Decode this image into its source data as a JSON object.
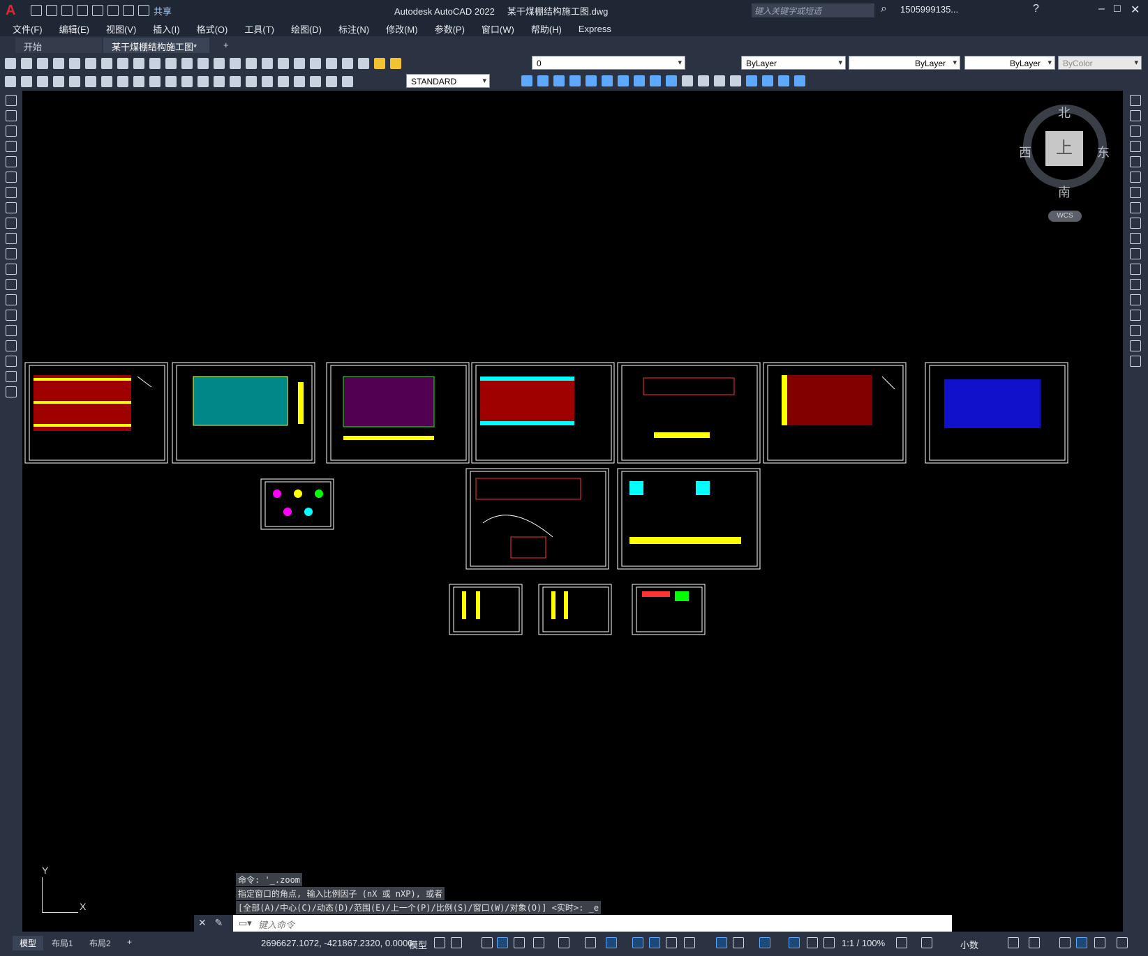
{
  "app": {
    "title": "Autodesk AutoCAD 2022",
    "filename": "某干煤棚结构施工图.dwg",
    "search_placeholder": "键入关键字或短语",
    "user": "1505999135...",
    "share_label": "共享"
  },
  "menu": [
    "文件(F)",
    "编辑(E)",
    "视图(V)",
    "插入(I)",
    "格式(O)",
    "工具(T)",
    "绘图(D)",
    "标注(N)",
    "修改(M)",
    "参数(P)",
    "窗口(W)",
    "帮助(H)",
    "Express"
  ],
  "tabs": {
    "start": "开始",
    "active": "某干煤棚结构施工图*",
    "add": "+"
  },
  "properties": {
    "layer": "0",
    "color": "ByLayer",
    "linetype": "ByLayer",
    "lineweight": "ByLayer",
    "plotstyle": "ByColor",
    "textstyle": "STANDARD"
  },
  "viewcube": {
    "top": "上",
    "north": "北",
    "south": "南",
    "east": "东",
    "west": "西",
    "wcs": "WCS"
  },
  "ucs": {
    "x": "X",
    "y": "Y"
  },
  "command": {
    "history": [
      "命令: '_.zoom",
      "指定窗口的角点, 输入比例因子 (nX 或 nXP), 或者",
      "[全部(A)/中心(C)/动态(D)/范围(E)/上一个(P)/比例(S)/窗口(W)/对象(O)] <实时>: _e"
    ],
    "placeholder": "键入命令"
  },
  "layouts": [
    "模型",
    "布局1",
    "布局2",
    "+"
  ],
  "status": {
    "coordinates": "2696627.1072, -421867.2320, 0.0000",
    "model": "模型",
    "scale": "1:1 / 100%",
    "units": "小数"
  },
  "colors": {
    "canvas": "#000000",
    "chrome": "#2b3241",
    "titlebar": "#1f2634",
    "accent": "#5fa8ff"
  }
}
